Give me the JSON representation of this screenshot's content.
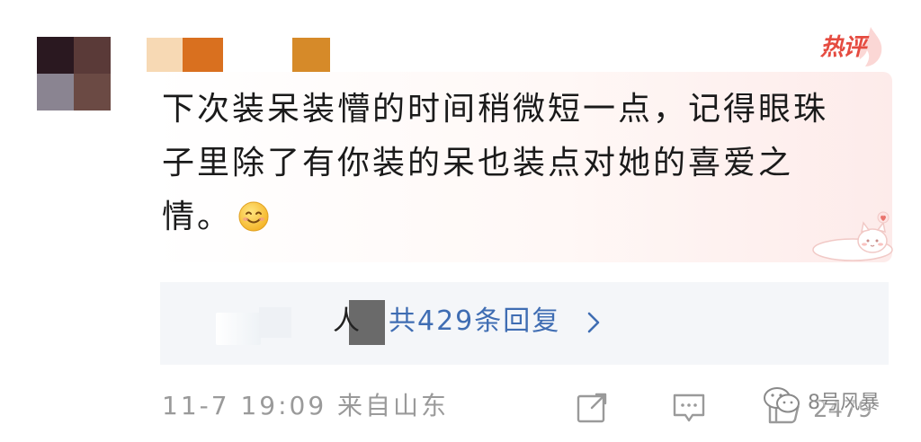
{
  "badge": {
    "hot_label": "热评"
  },
  "comment": {
    "text": "下次装呆装懵的时间稍微短一点，记得眼珠子里除了有你装的呆也装点对她的喜爱之情。",
    "emoji": "smile-emoji"
  },
  "replies": {
    "people_suffix": "人",
    "count_label": "共429条回复"
  },
  "footer": {
    "timestamp": "11-7 19:09 来自山东",
    "like_count": "2479"
  },
  "watermark": {
    "text": "8号风暴"
  },
  "colors": {
    "hot_badge": "#e54b40",
    "reply_link": "#3f6db3",
    "muted_text": "#9a9a9a",
    "reply_bar_bg": "#f4f6f9"
  },
  "icons": {
    "share": "share-icon",
    "comment": "comment-icon",
    "like": "like-icon",
    "chevron": "chevron-right-icon"
  }
}
